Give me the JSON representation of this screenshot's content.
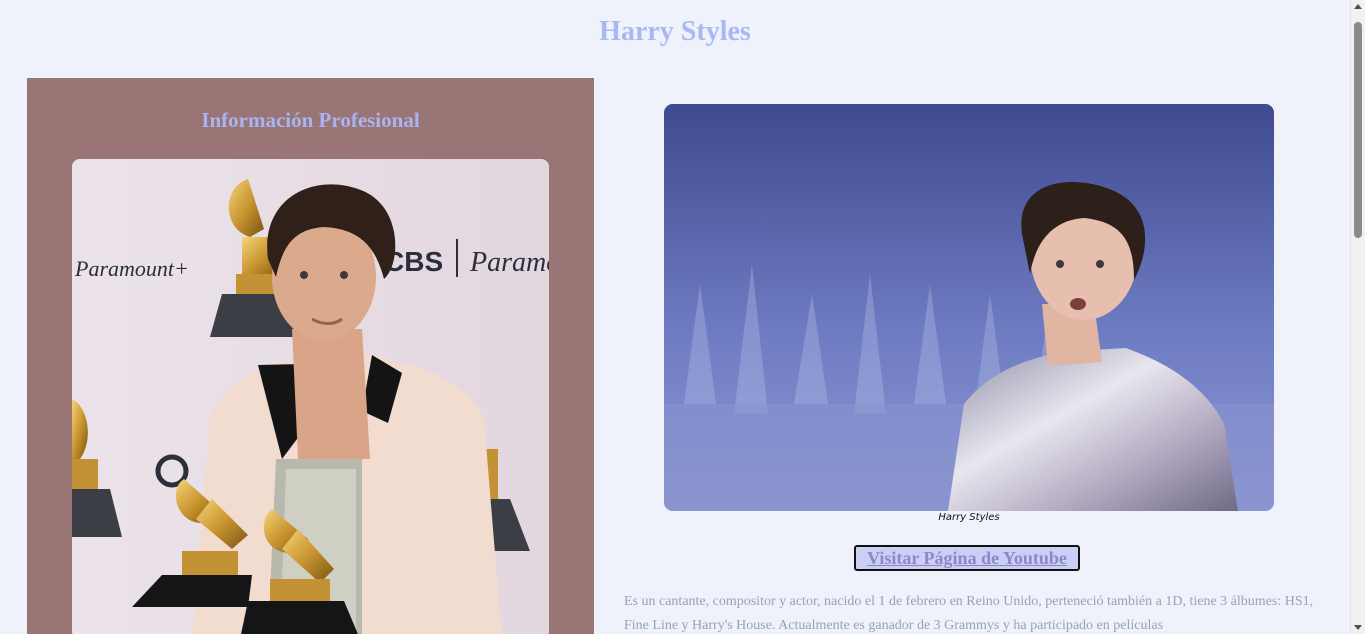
{
  "page": {
    "title": "Harry Styles"
  },
  "professional": {
    "heading": "Información Profesional",
    "photo_icon": "grammy-award-photo"
  },
  "concert": {
    "photo_icon": "concert-photo",
    "caption": "Harry Styles"
  },
  "youtube": {
    "label": "Visitar Página de Youtube"
  },
  "bio": {
    "text": "Es un cantante, compositor y actor, nacido el 1 de febrero en Reino Unido, perteneció también a 1D, tiene 3 álbumes: HS1, Fine Line y Harry's House. Actualmente es ganador de 3 Grammys y ha participado en películas"
  },
  "backdrop_text": {
    "sponsor_left": "Paramount+",
    "sponsor_right_cbs": "CBS",
    "sponsor_right_para": "Paramo"
  },
  "colors": {
    "background": "#eff2fb",
    "title": "#a8b8f4",
    "left_panel": "#997575",
    "button_bg": "#c9d0f3",
    "button_text": "#8f86c9",
    "body_text": "#9aa0b8"
  }
}
